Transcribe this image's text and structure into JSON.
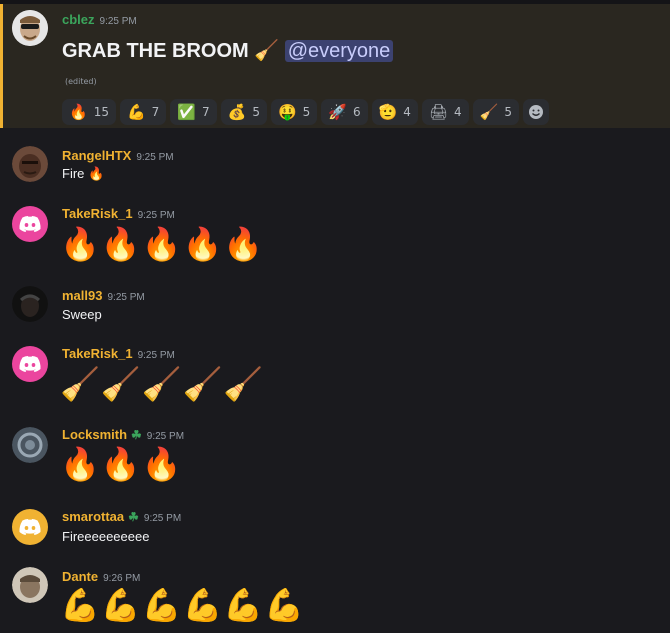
{
  "messages": [
    {
      "author": "cblez",
      "time": "9:25 PM",
      "text": "GRAB THE BROOM 🧹",
      "mention": "@everyone",
      "edited": "(edited)",
      "reactions": [
        {
          "emoji": "🔥",
          "count": "15"
        },
        {
          "emoji": "💪",
          "count": "7"
        },
        {
          "emoji": "✅",
          "count": "7"
        },
        {
          "emoji": "💰",
          "count": "5"
        },
        {
          "emoji": "🤑",
          "count": "5"
        },
        {
          "emoji": "🚀",
          "count": "6"
        },
        {
          "emoji": "🫡",
          "count": "4"
        },
        {
          "emoji": "🖨",
          "count": "4"
        },
        {
          "emoji": "🧹",
          "count": "5"
        }
      ]
    },
    {
      "author": "RangelHTX",
      "time": "9:25 PM",
      "text": "Fire 🔥"
    },
    {
      "author": "TakeRisk_1",
      "time": "9:25 PM",
      "text": "🔥🔥🔥🔥🔥"
    },
    {
      "author": "mall93",
      "time": "9:25 PM",
      "text": "Sweep"
    },
    {
      "author": "TakeRisk_1",
      "time": "9:25 PM",
      "text": "🧹🧹🧹🧹🧹"
    },
    {
      "author": "Locksmith",
      "badge": "☘",
      "time": "9:25 PM",
      "text": "🔥🔥🔥"
    },
    {
      "author": "smarottaa",
      "badge": "☘",
      "time": "9:25 PM",
      "text": "Fireeeeeeeeee"
    },
    {
      "author": "Dante",
      "time": "9:26 PM",
      "text": "💪💪💪💪💪💪"
    }
  ],
  "colors": {
    "name_green": "#3ba55c",
    "name_gold": "#f0b232",
    "discord_pink": "#eb459e",
    "discord_orange": "#f0b232"
  },
  "icons": {
    "discord_default_avatar": "discord-logo-icon",
    "add_reaction": "smiley-icon"
  }
}
